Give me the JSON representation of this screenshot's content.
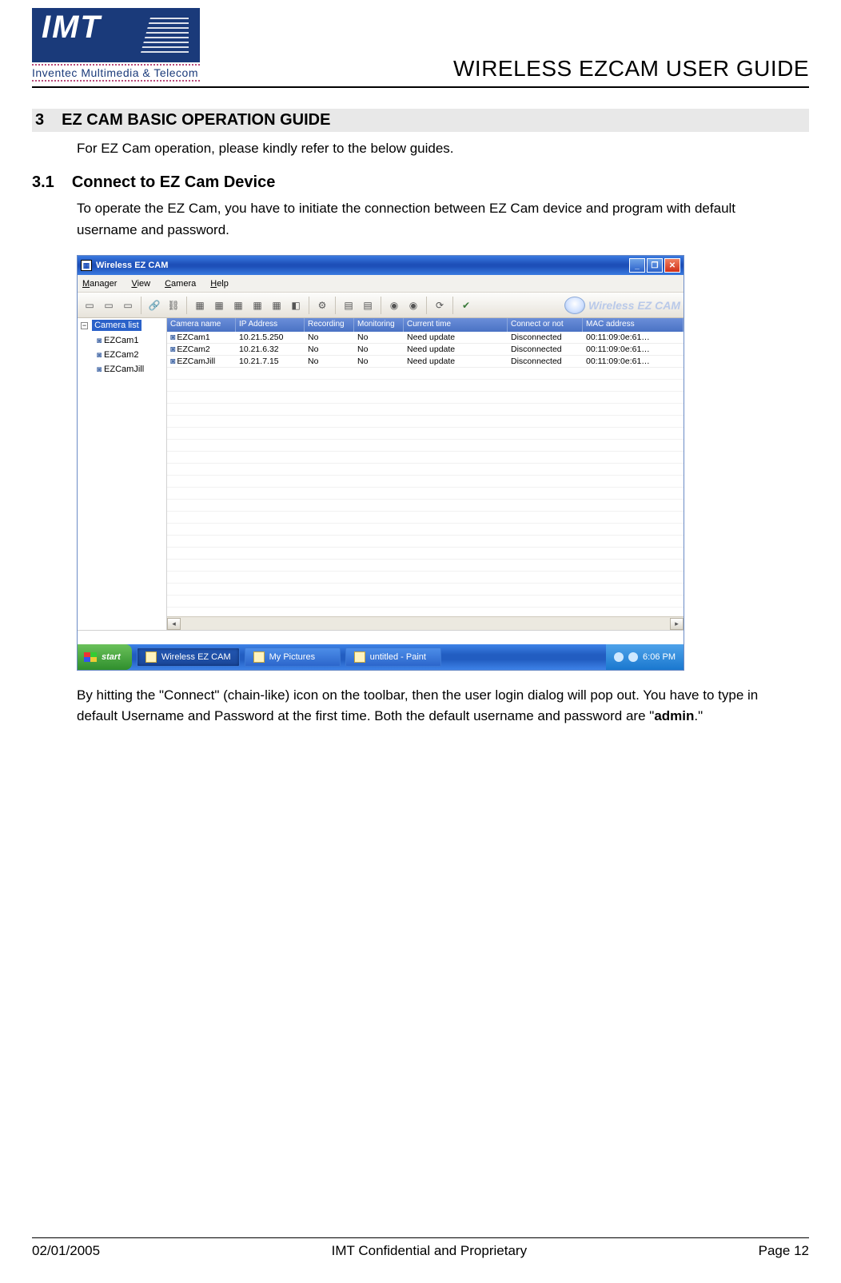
{
  "header": {
    "logo_text": "IMT",
    "logo_sub": "Inventec Multimedia & Telecom",
    "doc_title": "WIRELESS EZCAM USER GUIDE"
  },
  "section3": {
    "num": "3",
    "title": "EZ CAM BASIC OPERATION GUIDE",
    "intro": "For EZ Cam operation, please kindly refer to the below guides."
  },
  "section31": {
    "num": "3.1",
    "title": "Connect to EZ Cam Device",
    "para1": "To operate the EZ Cam, you have to initiate the connection between EZ Cam device and program with default username and password.",
    "para2_pre": "By hitting the \"Connect\" (chain-like) icon on the toolbar, then the user login dialog will pop out.  You have to type in default Username and Password at the first time.  Both the default username and password are \"",
    "para2_bold": "admin",
    "para2_post": ".\""
  },
  "app": {
    "window_title": "Wireless EZ CAM",
    "menu": [
      "Manager",
      "View",
      "Camera",
      "Help"
    ],
    "brand_tag": "Wireless EZ CAM",
    "tree_root": "Camera list",
    "tree_items": [
      "EZCam1",
      "EZCam2",
      "EZCamJill"
    ],
    "columns": [
      "Camera name",
      "IP Address",
      "Recording",
      "Monitoring",
      "Current time",
      "Connect or not",
      "MAC address"
    ],
    "rows": [
      {
        "name": "EZCam1",
        "ip": "10.21.5.250",
        "rec": "No",
        "mon": "No",
        "time": "Need update",
        "conn": "Disconnected",
        "mac": "00:11:09:0e:61…"
      },
      {
        "name": "EZCam2",
        "ip": "10.21.6.32",
        "rec": "No",
        "mon": "No",
        "time": "Need update",
        "conn": "Disconnected",
        "mac": "00:11:09:0e:61…"
      },
      {
        "name": "EZCamJill",
        "ip": "10.21.7.15",
        "rec": "No",
        "mon": "No",
        "time": "Need update",
        "conn": "Disconnected",
        "mac": "00:11:09:0e:61…"
      }
    ],
    "taskbar": {
      "start": "start",
      "items": [
        "Wireless EZ CAM",
        "My Pictures",
        "untitled - Paint"
      ],
      "clock": "6:06 PM"
    }
  },
  "footer": {
    "left": "02/01/2005",
    "center": "IMT Confidential and Proprietary",
    "right": "Page 12"
  }
}
